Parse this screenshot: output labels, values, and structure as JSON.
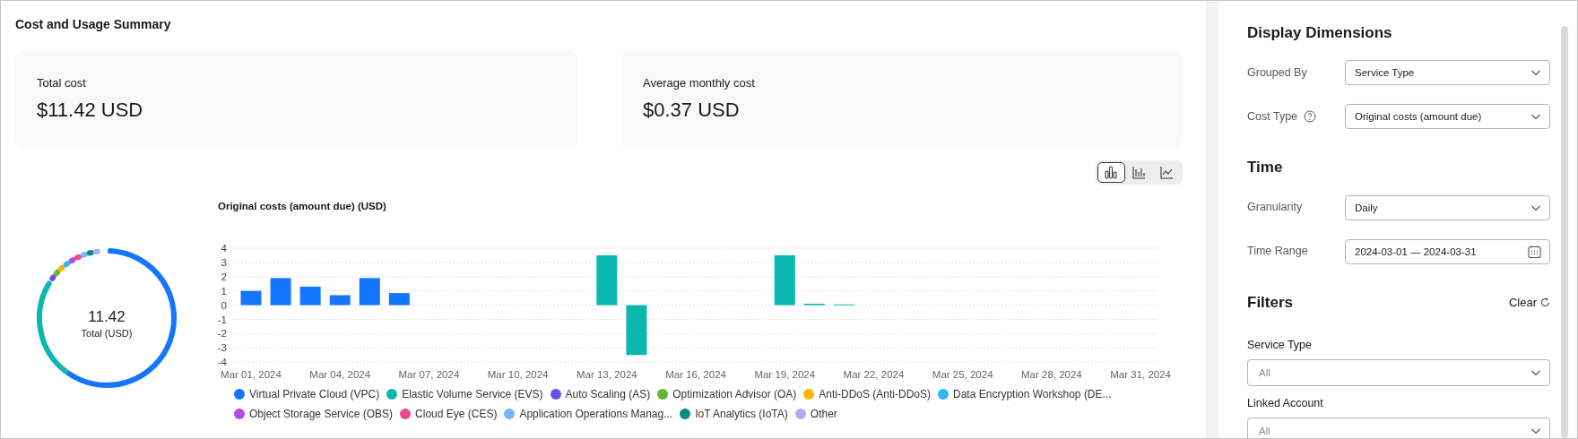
{
  "title": "Cost and Usage Summary",
  "summary_cards": [
    {
      "label": "Total cost",
      "value": "$11.42 USD"
    },
    {
      "label": "Average monthly cost",
      "value": "$0.37 USD"
    }
  ],
  "chart_types": [
    {
      "kind": "grouped",
      "selected": true
    },
    {
      "kind": "bar",
      "selected": false
    },
    {
      "kind": "line",
      "selected": false
    }
  ],
  "donut": {
    "value": "11.42",
    "caption": "Total (USD)"
  },
  "chart": {
    "chart_data": {
      "type": "bar",
      "title": "Original costs (amount due)  (USD)",
      "categories": [
        "Mar 01, 2024",
        null,
        null,
        "Mar 04, 2024",
        null,
        null,
        "Mar 07, 2024",
        null,
        null,
        "Mar 10, 2024",
        null,
        null,
        "Mar 13, 2024",
        null,
        null,
        "Mar 16, 2024",
        null,
        null,
        "Mar 19, 2024",
        null,
        null,
        "Mar 22, 2024",
        null,
        null,
        "Mar 25, 2024",
        null,
        null,
        "Mar 28, 2024",
        null,
        null,
        "Mar 31, 2024"
      ],
      "ylim": [
        -4,
        4
      ],
      "grid": true,
      "yticks": [
        4,
        3,
        2,
        1,
        0,
        -1,
        -2,
        -3,
        -4
      ],
      "series": [
        {
          "name": "Virtual Private Cloud (VPC)",
          "color": "#1476ff",
          "values": [
            1.0,
            1.9,
            1.3,
            0.7,
            1.9,
            0.85,
            null,
            null,
            null,
            null,
            null,
            null,
            null,
            null,
            null,
            null,
            null,
            null,
            null,
            null,
            null,
            null,
            null,
            null,
            null,
            null,
            null,
            null,
            null,
            null,
            null
          ]
        },
        {
          "name": "Elastic Volume Service (EVS)",
          "color": "#0bb8b0",
          "values": [
            null,
            null,
            null,
            null,
            null,
            null,
            null,
            null,
            null,
            null,
            null,
            null,
            3.5,
            -3.5,
            null,
            null,
            null,
            null,
            3.5,
            0.1,
            0.05,
            null,
            null,
            null,
            null,
            null,
            null,
            null,
            null,
            null,
            null
          ]
        },
        {
          "name": "Auto Scaling (AS)",
          "color": "#6c4fe0",
          "values": [
            null,
            null,
            null,
            null,
            null,
            null,
            null,
            null,
            null,
            null,
            null,
            null,
            null,
            null,
            null,
            null,
            null,
            null,
            null,
            null,
            null,
            null,
            null,
            null,
            null,
            null,
            null,
            null,
            null,
            null,
            null
          ]
        },
        {
          "name": "Optimization Advisor (OA)",
          "color": "#5cb82c",
          "values": [
            null,
            null,
            null,
            null,
            null,
            null,
            null,
            null,
            null,
            null,
            null,
            null,
            null,
            null,
            null,
            null,
            null,
            null,
            null,
            null,
            null,
            null,
            null,
            null,
            null,
            null,
            null,
            null,
            null,
            null,
            null
          ]
        },
        {
          "name": "Anti-DDoS (Anti-DDoS)",
          "color": "#ffb300",
          "values": [
            null,
            null,
            null,
            null,
            null,
            null,
            null,
            null,
            null,
            null,
            null,
            null,
            null,
            null,
            null,
            null,
            null,
            null,
            null,
            null,
            null,
            null,
            null,
            null,
            null,
            null,
            null,
            null,
            null,
            null,
            null
          ]
        },
        {
          "name": "Data Encryption Workshop (DE...",
          "color": "#30b8f0",
          "values": [
            null,
            null,
            null,
            null,
            null,
            null,
            null,
            null,
            null,
            null,
            null,
            null,
            null,
            null,
            null,
            null,
            null,
            null,
            null,
            null,
            null,
            null,
            null,
            null,
            null,
            null,
            null,
            null,
            null,
            null,
            null
          ]
        },
        {
          "name": "Object Storage Service (OBS)",
          "color": "#b150e0",
          "values": [
            null,
            null,
            null,
            null,
            null,
            null,
            null,
            null,
            null,
            null,
            null,
            null,
            null,
            null,
            null,
            null,
            null,
            null,
            null,
            null,
            null,
            null,
            null,
            null,
            null,
            null,
            null,
            null,
            null,
            null,
            null
          ]
        },
        {
          "name": "Cloud Eye (CES)",
          "color": "#ee4a8e",
          "values": [
            null,
            null,
            null,
            null,
            null,
            null,
            null,
            null,
            null,
            null,
            null,
            null,
            null,
            null,
            null,
            null,
            null,
            null,
            null,
            null,
            null,
            null,
            null,
            null,
            null,
            null,
            null,
            null,
            null,
            null,
            null
          ]
        },
        {
          "name": "Application Operations Manag...",
          "color": "#78b4ff",
          "values": [
            null,
            null,
            null,
            null,
            null,
            null,
            null,
            null,
            null,
            null,
            null,
            null,
            null,
            null,
            null,
            null,
            null,
            null,
            null,
            null,
            null,
            null,
            null,
            null,
            null,
            null,
            null,
            null,
            null,
            null,
            null
          ]
        },
        {
          "name": "IoT Analytics (IoTA)",
          "color": "#0a8a85",
          "values": [
            null,
            null,
            null,
            null,
            null,
            null,
            null,
            null,
            null,
            null,
            null,
            null,
            null,
            null,
            null,
            null,
            null,
            null,
            null,
            null,
            null,
            null,
            null,
            null,
            null,
            null,
            null,
            null,
            null,
            null,
            null
          ]
        },
        {
          "name": "Other",
          "color": "#b9a7f5",
          "values": [
            null,
            null,
            null,
            null,
            null,
            null,
            null,
            null,
            null,
            null,
            null,
            null,
            null,
            null,
            null,
            null,
            null,
            null,
            null,
            null,
            null,
            null,
            null,
            null,
            null,
            null,
            null,
            null,
            null,
            null,
            null
          ]
        }
      ]
    }
  },
  "panel": {
    "sections": [
      {
        "heading": "Display Dimensions",
        "kind": "inline",
        "fields": [
          {
            "label": "Grouped By",
            "kind": "select",
            "value": "Service Type",
            "help": false
          },
          {
            "label": "Cost Type",
            "kind": "select",
            "value": "Original costs (amount due)",
            "help": true
          }
        ]
      },
      {
        "heading": "Time",
        "kind": "inline",
        "fields": [
          {
            "label": "Granularity",
            "kind": "select",
            "value": "Daily",
            "help": false
          },
          {
            "label": "Time Range",
            "kind": "date",
            "value": "2024-03-01 — 2024-03-31",
            "help": false
          }
        ]
      },
      {
        "heading": "Filters",
        "clear": "Clear",
        "kind": "stacked",
        "fields": [
          {
            "label": "Service Type",
            "kind": "select",
            "placeholder": "All",
            "help": false
          },
          {
            "label": "Linked Account",
            "kind": "select",
            "placeholder": "All",
            "help": false
          }
        ]
      }
    ]
  }
}
